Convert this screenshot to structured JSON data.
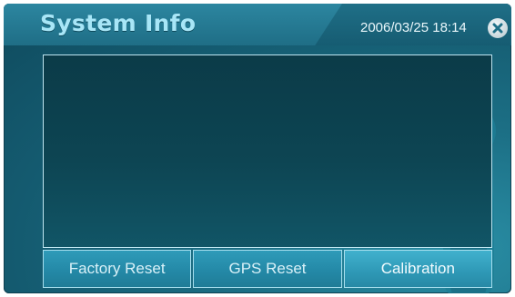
{
  "window": {
    "title": "System Info",
    "datetime": "2006/03/25 18:14",
    "close_icon": "close-icon"
  },
  "buttons": [
    {
      "label": "Factory Reset"
    },
    {
      "label": "GPS Reset"
    },
    {
      "label": "Calibration"
    }
  ],
  "theme": {
    "background": "#145a6f",
    "accent": "#a8e6f7",
    "button": "#2489a7"
  }
}
